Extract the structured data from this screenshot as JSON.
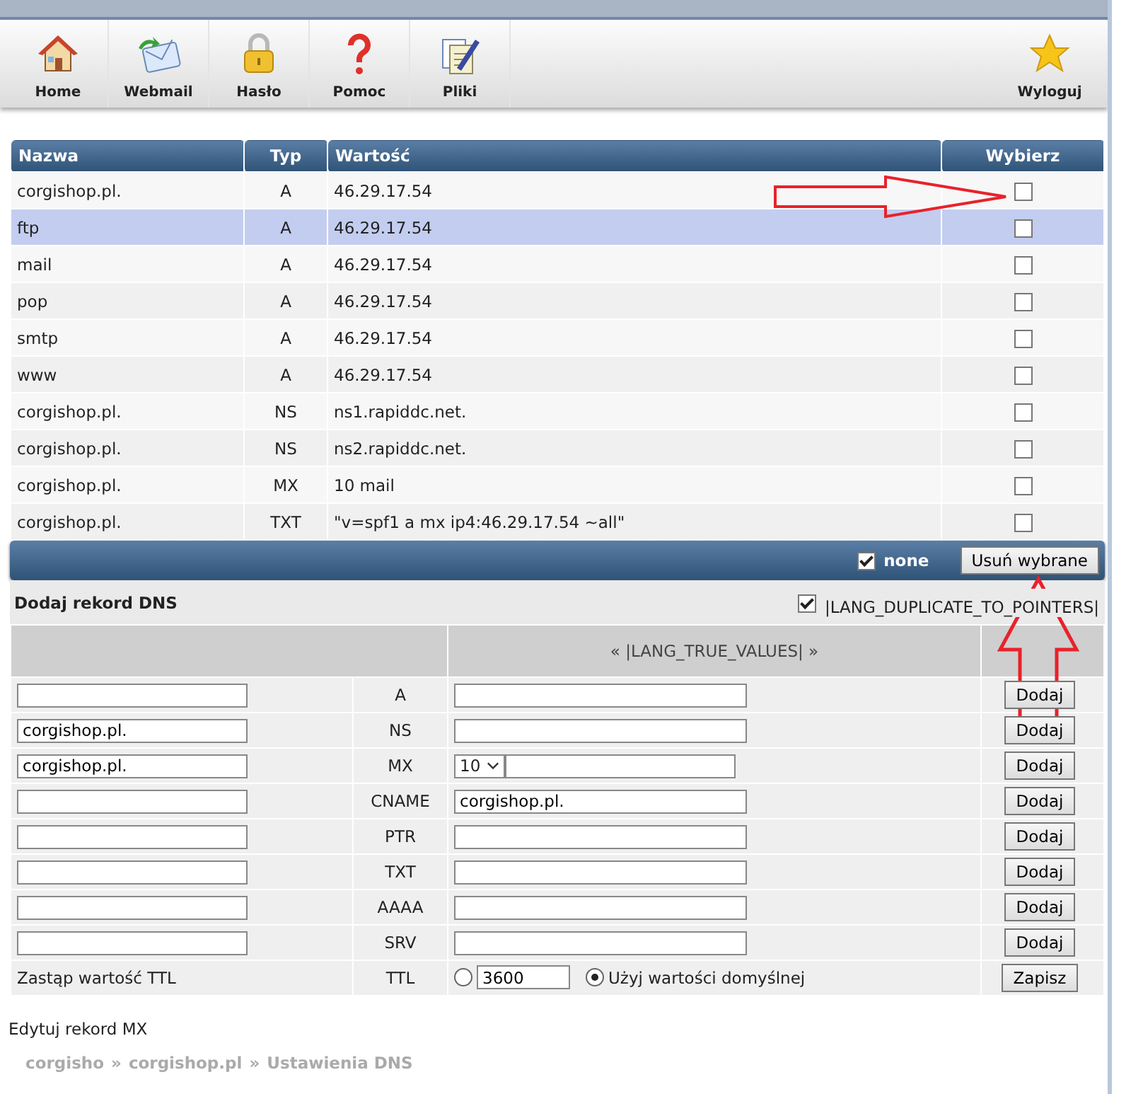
{
  "toolbar": [
    {
      "label": "Home"
    },
    {
      "label": "Webmail"
    },
    {
      "label": "Hasło"
    },
    {
      "label": "Pomoc"
    },
    {
      "label": "Pliki"
    }
  ],
  "logout": {
    "label": "Wyloguj"
  },
  "records_table": {
    "columns": [
      "Nazwa",
      "Typ",
      "Wartość",
      "Wybierz"
    ],
    "rows": [
      {
        "name": "corgishop.pl.",
        "type": "A",
        "value": "46.29.17.54",
        "selected": false,
        "checked": false
      },
      {
        "name": "ftp",
        "type": "A",
        "value": "46.29.17.54",
        "selected": true,
        "checked": false
      },
      {
        "name": "mail",
        "type": "A",
        "value": "46.29.17.54",
        "selected": false,
        "checked": false
      },
      {
        "name": "pop",
        "type": "A",
        "value": "46.29.17.54",
        "selected": false,
        "checked": false
      },
      {
        "name": "smtp",
        "type": "A",
        "value": "46.29.17.54",
        "selected": false,
        "checked": false
      },
      {
        "name": "www",
        "type": "A",
        "value": "46.29.17.54",
        "selected": false,
        "checked": false
      },
      {
        "name": "corgishop.pl.",
        "type": "NS",
        "value": "ns1.rapiddc.net.",
        "selected": false,
        "checked": false
      },
      {
        "name": "corgishop.pl.",
        "type": "NS",
        "value": "ns2.rapiddc.net.",
        "selected": false,
        "checked": false
      },
      {
        "name": "corgishop.pl.",
        "type": "MX",
        "value": "10 mail",
        "selected": false,
        "checked": false
      },
      {
        "name": "corgishop.pl.",
        "type": "TXT",
        "value": "\"v=spf1 a mx ip4:46.29.17.54 ~all\"",
        "selected": false,
        "checked": false
      }
    ],
    "footer": {
      "select_all_label": "none",
      "select_all_checked": true,
      "delete_button": "Usuń wybrane"
    }
  },
  "add_form": {
    "title": "Dodaj rekord DNS",
    "duplicate_label": "|LANG_DUPLICATE_TO_POINTERS|",
    "duplicate_checked": true,
    "header_values": "« |LANG_TRUE_VALUES| »",
    "rows": [
      {
        "kind": "text",
        "name": "",
        "type": "A",
        "value": "",
        "button": "Dodaj"
      },
      {
        "kind": "text",
        "name": "corgishop.pl.",
        "type": "NS",
        "value": "",
        "button": "Dodaj"
      },
      {
        "kind": "mx",
        "name": "corgishop.pl.",
        "type": "MX",
        "priority": "10",
        "value": "",
        "button": "Dodaj"
      },
      {
        "kind": "text",
        "name": "",
        "type": "CNAME",
        "value": "corgishop.pl.",
        "button": "Dodaj"
      },
      {
        "kind": "text",
        "name": "",
        "type": "PTR",
        "value": "",
        "button": "Dodaj"
      },
      {
        "kind": "text",
        "name": "",
        "type": "TXT",
        "value": "",
        "button": "Dodaj"
      },
      {
        "kind": "text",
        "name": "",
        "type": "AAAA",
        "value": "",
        "button": "Dodaj"
      },
      {
        "kind": "text",
        "name": "",
        "type": "SRV",
        "value": "",
        "button": "Dodaj"
      }
    ],
    "ttl": {
      "label": "Zastąp wartość TTL",
      "type": "TTL",
      "custom_selected": false,
      "custom_value": "3600",
      "default_selected": true,
      "default_label": "Użyj wartości domyślnej",
      "button": "Zapisz"
    }
  },
  "edit_link": "Edytuj rekord MX",
  "breadcrumb": [
    "corgisho",
    "»",
    "corgishop.pl",
    "»",
    "Ustawienia DNS"
  ]
}
